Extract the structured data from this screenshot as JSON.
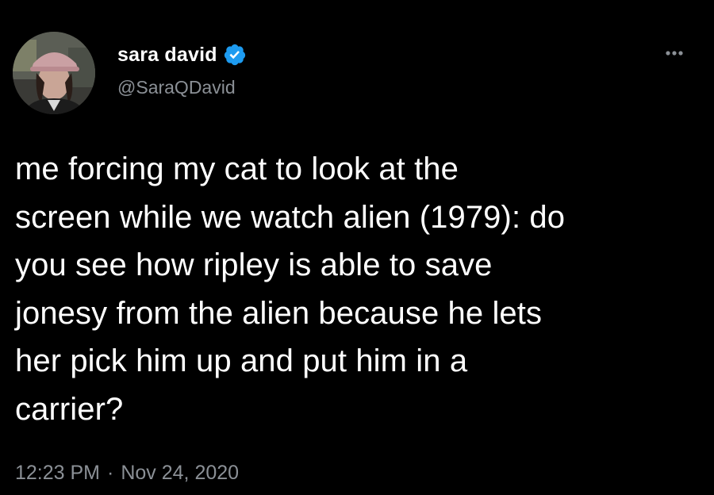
{
  "author": {
    "display_name": "sara david",
    "handle": "@SaraQDavid",
    "verified": true,
    "verified_color": "#1d9bf0"
  },
  "icons": {
    "verified": "verified-badge-icon",
    "more": "more-options-icon"
  },
  "tweet": {
    "lines": [
      "me forcing my cat to look at the",
      "screen while we watch alien (1979): do",
      "you see how ripley is able to save",
      "jonesy from the alien because he lets",
      "her pick him up and put him in a",
      "carrier?"
    ],
    "time": "12:23 PM",
    "separator": "·",
    "date": "Nov 24, 2020"
  },
  "colors": {
    "background": "#000000",
    "text": "#ffffff",
    "secondary_text": "#8b9096"
  }
}
